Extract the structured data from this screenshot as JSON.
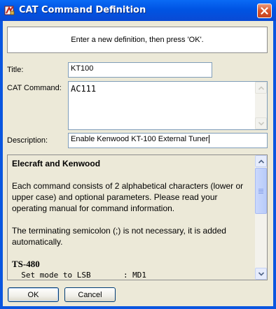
{
  "window": {
    "title": "CAT Command Definition"
  },
  "banner": {
    "text": "Enter a new definition, then press 'OK'."
  },
  "form": {
    "title_label": "Title:",
    "title_value": "KT100",
    "command_label": "CAT Command:",
    "command_value": "AC111",
    "description_label": "Description:",
    "description_value": "Enable Kenwood KT-100 External Tuner"
  },
  "help": {
    "heading": "Elecraft and Kenwood",
    "para1": "Each command consists of 2 alphabetical characters (lower or upper case) and optional parameters. Please read your operating manual for command information.",
    "para2": "The terminating semicolon (;) is not necessary, it is added automatically.",
    "subheading": "TS-480",
    "code_line": "  Set mode to LSB       : MD1"
  },
  "buttons": {
    "ok": "OK",
    "cancel": "Cancel"
  },
  "icons": {
    "app": "cat-app-icon",
    "close": "close-icon"
  }
}
